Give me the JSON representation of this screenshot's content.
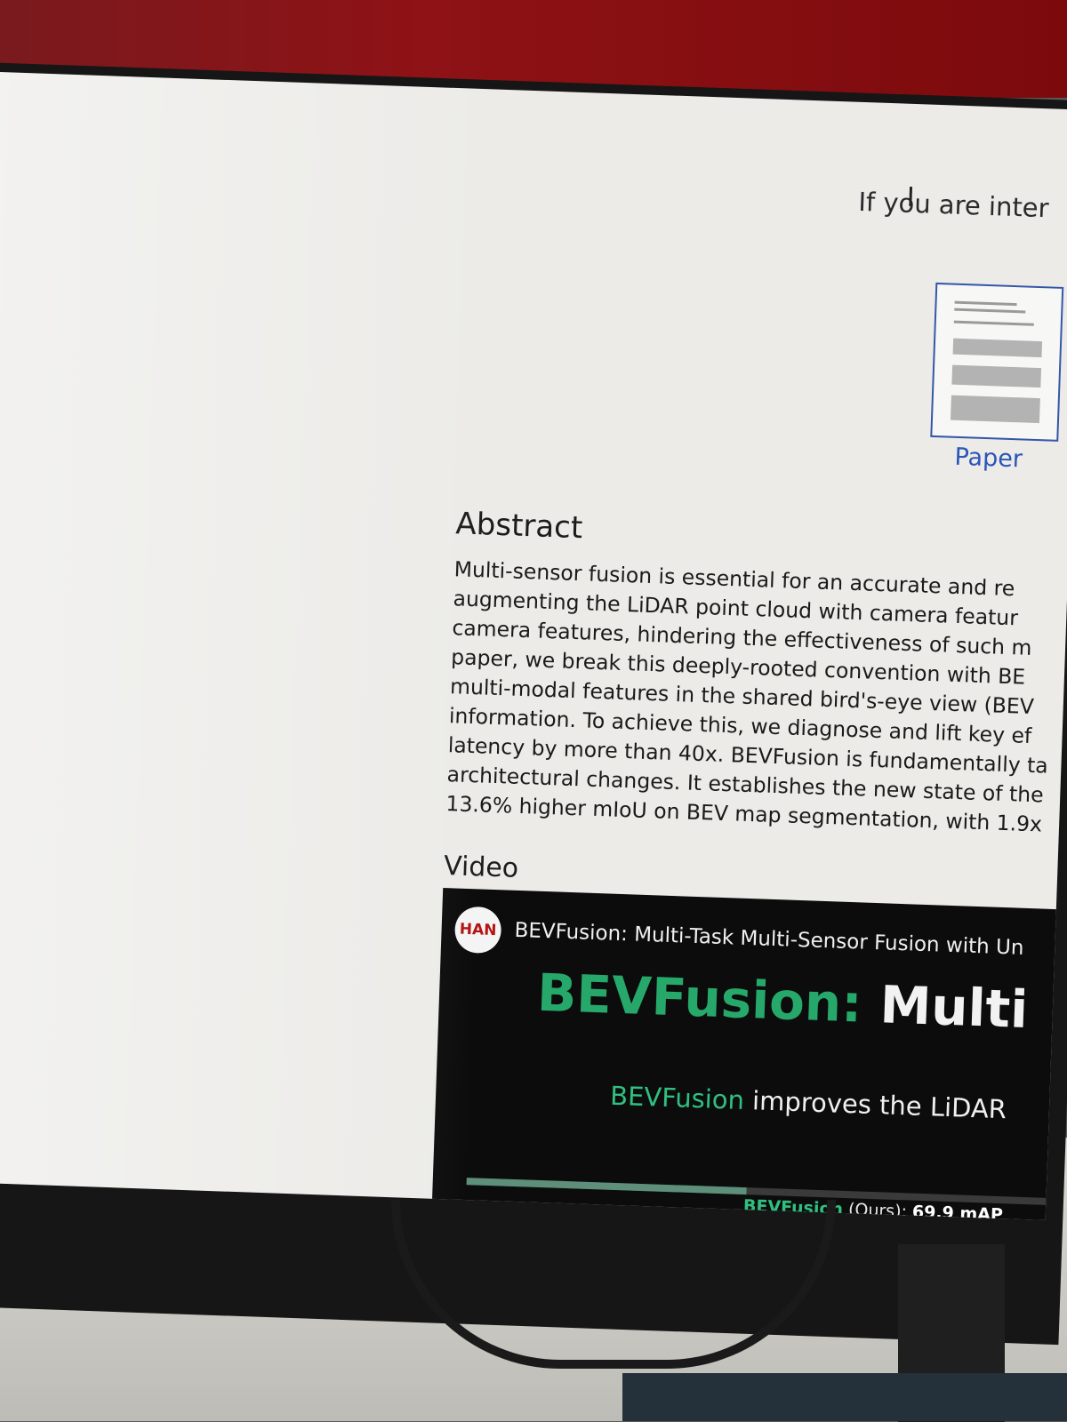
{
  "page": {
    "cta_text": "If you are inter",
    "paper_link": "Paper"
  },
  "abstract": {
    "heading": "Abstract",
    "lines": [
      "Multi-sensor fusion is essential for an accurate and re",
      "augmenting the LiDAR point cloud with camera featur",
      "camera features, hindering the effectiveness of such m",
      "paper, we break this deeply-rooted convention with BE",
      "multi-modal features in the shared bird's-eye view (BEV",
      "information. To achieve this, we diagnose and lift key ef",
      "latency by more than 40x. BEVFusion is fundamentally ta",
      "architectural changes. It establishes the new state of the",
      "13.6% higher mIoU on BEV map segmentation, with 1.9x"
    ]
  },
  "video": {
    "heading": "Video",
    "channel_avatar_text": "HAN",
    "title": "BEVFusion: Multi-Task Multi-Sensor Fusion with Un",
    "headline_green": "BEVFusion:",
    "headline_white": " Multi",
    "subline_green": "BEVFusion",
    "subline_rest": " improves the LiDAR",
    "result_green": "BEVFusion",
    "result_mid": " (Ours): ",
    "result_value": "69.9 mAP",
    "progress": 0.45
  },
  "colors": {
    "link": "#2b56b8",
    "accent_green": "#27a86b",
    "wall_red": "#8e1216"
  }
}
